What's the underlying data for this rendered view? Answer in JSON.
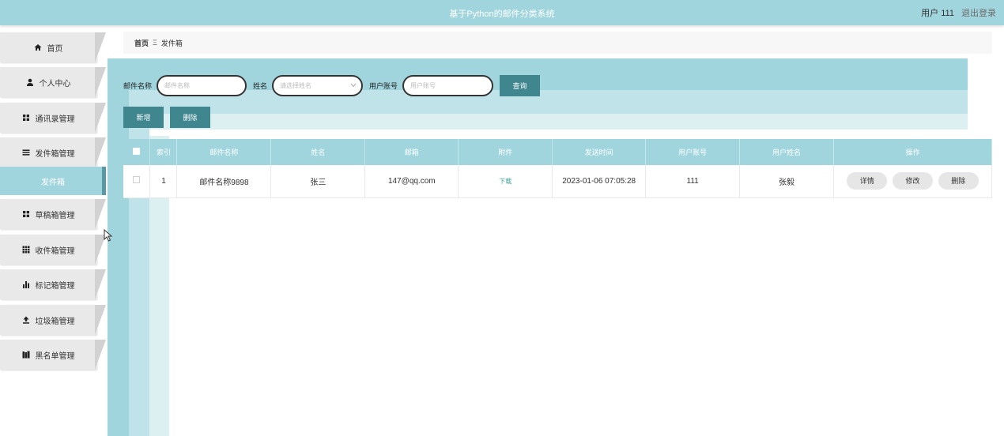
{
  "header": {
    "title": "基于Python的邮件分类系统",
    "user_label": "用户 111",
    "logout_label": "退出登录"
  },
  "sidebar": {
    "items": [
      {
        "label": "首页",
        "icon": "home-icon"
      },
      {
        "label": "个人中心",
        "icon": "person-icon"
      },
      {
        "label": "通讯录管理",
        "icon": "grid-icon"
      },
      {
        "label": "发件箱管理",
        "icon": "list-icon"
      },
      {
        "label": "草稿箱管理",
        "icon": "grid-icon"
      },
      {
        "label": "收件箱管理",
        "icon": "grid-dense-icon"
      },
      {
        "label": "标记箱管理",
        "icon": "bar-chart-icon"
      },
      {
        "label": "垃圾箱管理",
        "icon": "upload-icon"
      },
      {
        "label": "黑名单管理",
        "icon": "book-icon"
      }
    ],
    "active_sub": "发件箱"
  },
  "breadcrumb": {
    "home": "首页",
    "separator": "Ξ",
    "current": "发件箱"
  },
  "search": {
    "mail_name_label": "邮件名称",
    "mail_name_placeholder": "邮件名称",
    "name_label": "姓名",
    "name_placeholder": "请选择姓名",
    "account_label": "用户账号",
    "account_placeholder": "用户账号",
    "query_button": "查询"
  },
  "actions": {
    "add_button": "新增",
    "delete_button": "删除"
  },
  "table": {
    "columns": [
      "索引",
      "邮件名称",
      "姓名",
      "邮箱",
      "附件",
      "发送时间",
      "用户账号",
      "用户姓名",
      "操作"
    ],
    "rows": [
      {
        "index": "1",
        "mail_name": "邮件名称9898",
        "name": "张三",
        "email": "147@qq.com",
        "attachment": "下载",
        "send_time": "2023-01-06 07:05:28",
        "account": "111",
        "user_name": "张毅",
        "ops": {
          "detail": "详情",
          "edit": "修改",
          "delete": "删除"
        }
      }
    ]
  },
  "colors": {
    "accent": "#a1d5dd",
    "button": "#3f868e",
    "download_link": "#3fa39a"
  }
}
